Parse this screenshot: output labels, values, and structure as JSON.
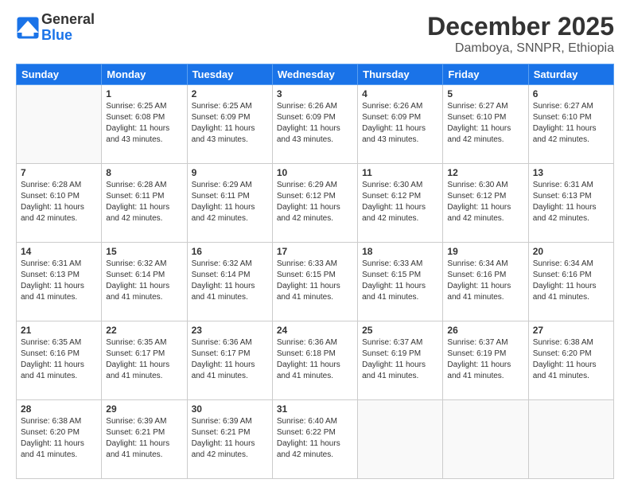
{
  "header": {
    "logo_line1": "General",
    "logo_line2": "Blue",
    "month_title": "December 2025",
    "location": "Damboya, SNNPR, Ethiopia"
  },
  "weekdays": [
    "Sunday",
    "Monday",
    "Tuesday",
    "Wednesday",
    "Thursday",
    "Friday",
    "Saturday"
  ],
  "weeks": [
    [
      {
        "day": "",
        "info": ""
      },
      {
        "day": "1",
        "info": "Sunrise: 6:25 AM\nSunset: 6:08 PM\nDaylight: 11 hours\nand 43 minutes."
      },
      {
        "day": "2",
        "info": "Sunrise: 6:25 AM\nSunset: 6:09 PM\nDaylight: 11 hours\nand 43 minutes."
      },
      {
        "day": "3",
        "info": "Sunrise: 6:26 AM\nSunset: 6:09 PM\nDaylight: 11 hours\nand 43 minutes."
      },
      {
        "day": "4",
        "info": "Sunrise: 6:26 AM\nSunset: 6:09 PM\nDaylight: 11 hours\nand 43 minutes."
      },
      {
        "day": "5",
        "info": "Sunrise: 6:27 AM\nSunset: 6:10 PM\nDaylight: 11 hours\nand 42 minutes."
      },
      {
        "day": "6",
        "info": "Sunrise: 6:27 AM\nSunset: 6:10 PM\nDaylight: 11 hours\nand 42 minutes."
      }
    ],
    [
      {
        "day": "7",
        "info": "Sunrise: 6:28 AM\nSunset: 6:10 PM\nDaylight: 11 hours\nand 42 minutes."
      },
      {
        "day": "8",
        "info": "Sunrise: 6:28 AM\nSunset: 6:11 PM\nDaylight: 11 hours\nand 42 minutes."
      },
      {
        "day": "9",
        "info": "Sunrise: 6:29 AM\nSunset: 6:11 PM\nDaylight: 11 hours\nand 42 minutes."
      },
      {
        "day": "10",
        "info": "Sunrise: 6:29 AM\nSunset: 6:12 PM\nDaylight: 11 hours\nand 42 minutes."
      },
      {
        "day": "11",
        "info": "Sunrise: 6:30 AM\nSunset: 6:12 PM\nDaylight: 11 hours\nand 42 minutes."
      },
      {
        "day": "12",
        "info": "Sunrise: 6:30 AM\nSunset: 6:12 PM\nDaylight: 11 hours\nand 42 minutes."
      },
      {
        "day": "13",
        "info": "Sunrise: 6:31 AM\nSunset: 6:13 PM\nDaylight: 11 hours\nand 42 minutes."
      }
    ],
    [
      {
        "day": "14",
        "info": "Sunrise: 6:31 AM\nSunset: 6:13 PM\nDaylight: 11 hours\nand 41 minutes."
      },
      {
        "day": "15",
        "info": "Sunrise: 6:32 AM\nSunset: 6:14 PM\nDaylight: 11 hours\nand 41 minutes."
      },
      {
        "day": "16",
        "info": "Sunrise: 6:32 AM\nSunset: 6:14 PM\nDaylight: 11 hours\nand 41 minutes."
      },
      {
        "day": "17",
        "info": "Sunrise: 6:33 AM\nSunset: 6:15 PM\nDaylight: 11 hours\nand 41 minutes."
      },
      {
        "day": "18",
        "info": "Sunrise: 6:33 AM\nSunset: 6:15 PM\nDaylight: 11 hours\nand 41 minutes."
      },
      {
        "day": "19",
        "info": "Sunrise: 6:34 AM\nSunset: 6:16 PM\nDaylight: 11 hours\nand 41 minutes."
      },
      {
        "day": "20",
        "info": "Sunrise: 6:34 AM\nSunset: 6:16 PM\nDaylight: 11 hours\nand 41 minutes."
      }
    ],
    [
      {
        "day": "21",
        "info": "Sunrise: 6:35 AM\nSunset: 6:16 PM\nDaylight: 11 hours\nand 41 minutes."
      },
      {
        "day": "22",
        "info": "Sunrise: 6:35 AM\nSunset: 6:17 PM\nDaylight: 11 hours\nand 41 minutes."
      },
      {
        "day": "23",
        "info": "Sunrise: 6:36 AM\nSunset: 6:17 PM\nDaylight: 11 hours\nand 41 minutes."
      },
      {
        "day": "24",
        "info": "Sunrise: 6:36 AM\nSunset: 6:18 PM\nDaylight: 11 hours\nand 41 minutes."
      },
      {
        "day": "25",
        "info": "Sunrise: 6:37 AM\nSunset: 6:19 PM\nDaylight: 11 hours\nand 41 minutes."
      },
      {
        "day": "26",
        "info": "Sunrise: 6:37 AM\nSunset: 6:19 PM\nDaylight: 11 hours\nand 41 minutes."
      },
      {
        "day": "27",
        "info": "Sunrise: 6:38 AM\nSunset: 6:20 PM\nDaylight: 11 hours\nand 41 minutes."
      }
    ],
    [
      {
        "day": "28",
        "info": "Sunrise: 6:38 AM\nSunset: 6:20 PM\nDaylight: 11 hours\nand 41 minutes."
      },
      {
        "day": "29",
        "info": "Sunrise: 6:39 AM\nSunset: 6:21 PM\nDaylight: 11 hours\nand 41 minutes."
      },
      {
        "day": "30",
        "info": "Sunrise: 6:39 AM\nSunset: 6:21 PM\nDaylight: 11 hours\nand 42 minutes."
      },
      {
        "day": "31",
        "info": "Sunrise: 6:40 AM\nSunset: 6:22 PM\nDaylight: 11 hours\nand 42 minutes."
      },
      {
        "day": "",
        "info": ""
      },
      {
        "day": "",
        "info": ""
      },
      {
        "day": "",
        "info": ""
      }
    ]
  ]
}
